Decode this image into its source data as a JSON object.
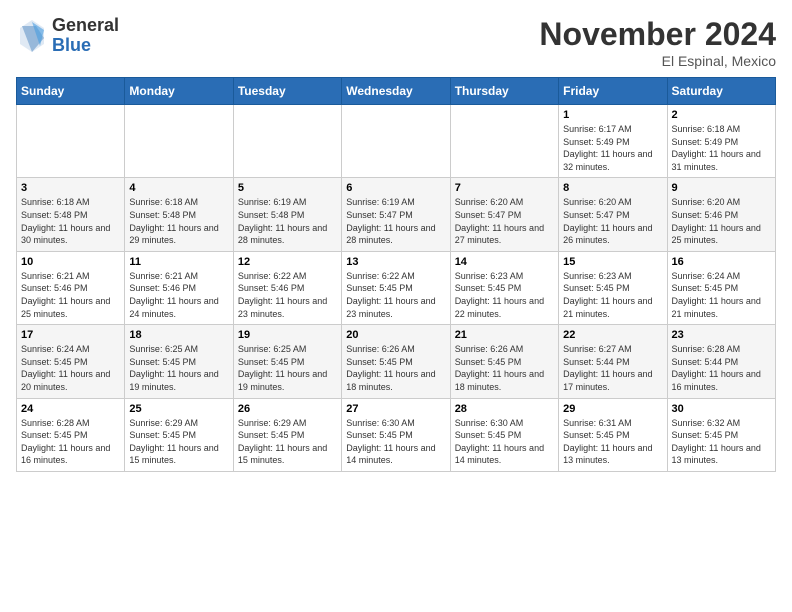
{
  "logo": {
    "general": "General",
    "blue": "Blue"
  },
  "title": "November 2024",
  "subtitle": "El Espinal, Mexico",
  "days_of_week": [
    "Sunday",
    "Monday",
    "Tuesday",
    "Wednesday",
    "Thursday",
    "Friday",
    "Saturday"
  ],
  "weeks": [
    [
      {
        "day": "",
        "info": ""
      },
      {
        "day": "",
        "info": ""
      },
      {
        "day": "",
        "info": ""
      },
      {
        "day": "",
        "info": ""
      },
      {
        "day": "",
        "info": ""
      },
      {
        "day": "1",
        "info": "Sunrise: 6:17 AM\nSunset: 5:49 PM\nDaylight: 11 hours and 32 minutes."
      },
      {
        "day": "2",
        "info": "Sunrise: 6:18 AM\nSunset: 5:49 PM\nDaylight: 11 hours and 31 minutes."
      }
    ],
    [
      {
        "day": "3",
        "info": "Sunrise: 6:18 AM\nSunset: 5:48 PM\nDaylight: 11 hours and 30 minutes."
      },
      {
        "day": "4",
        "info": "Sunrise: 6:18 AM\nSunset: 5:48 PM\nDaylight: 11 hours and 29 minutes."
      },
      {
        "day": "5",
        "info": "Sunrise: 6:19 AM\nSunset: 5:48 PM\nDaylight: 11 hours and 28 minutes."
      },
      {
        "day": "6",
        "info": "Sunrise: 6:19 AM\nSunset: 5:47 PM\nDaylight: 11 hours and 28 minutes."
      },
      {
        "day": "7",
        "info": "Sunrise: 6:20 AM\nSunset: 5:47 PM\nDaylight: 11 hours and 27 minutes."
      },
      {
        "day": "8",
        "info": "Sunrise: 6:20 AM\nSunset: 5:47 PM\nDaylight: 11 hours and 26 minutes."
      },
      {
        "day": "9",
        "info": "Sunrise: 6:20 AM\nSunset: 5:46 PM\nDaylight: 11 hours and 25 minutes."
      }
    ],
    [
      {
        "day": "10",
        "info": "Sunrise: 6:21 AM\nSunset: 5:46 PM\nDaylight: 11 hours and 25 minutes."
      },
      {
        "day": "11",
        "info": "Sunrise: 6:21 AM\nSunset: 5:46 PM\nDaylight: 11 hours and 24 minutes."
      },
      {
        "day": "12",
        "info": "Sunrise: 6:22 AM\nSunset: 5:46 PM\nDaylight: 11 hours and 23 minutes."
      },
      {
        "day": "13",
        "info": "Sunrise: 6:22 AM\nSunset: 5:45 PM\nDaylight: 11 hours and 23 minutes."
      },
      {
        "day": "14",
        "info": "Sunrise: 6:23 AM\nSunset: 5:45 PM\nDaylight: 11 hours and 22 minutes."
      },
      {
        "day": "15",
        "info": "Sunrise: 6:23 AM\nSunset: 5:45 PM\nDaylight: 11 hours and 21 minutes."
      },
      {
        "day": "16",
        "info": "Sunrise: 6:24 AM\nSunset: 5:45 PM\nDaylight: 11 hours and 21 minutes."
      }
    ],
    [
      {
        "day": "17",
        "info": "Sunrise: 6:24 AM\nSunset: 5:45 PM\nDaylight: 11 hours and 20 minutes."
      },
      {
        "day": "18",
        "info": "Sunrise: 6:25 AM\nSunset: 5:45 PM\nDaylight: 11 hours and 19 minutes."
      },
      {
        "day": "19",
        "info": "Sunrise: 6:25 AM\nSunset: 5:45 PM\nDaylight: 11 hours and 19 minutes."
      },
      {
        "day": "20",
        "info": "Sunrise: 6:26 AM\nSunset: 5:45 PM\nDaylight: 11 hours and 18 minutes."
      },
      {
        "day": "21",
        "info": "Sunrise: 6:26 AM\nSunset: 5:45 PM\nDaylight: 11 hours and 18 minutes."
      },
      {
        "day": "22",
        "info": "Sunrise: 6:27 AM\nSunset: 5:44 PM\nDaylight: 11 hours and 17 minutes."
      },
      {
        "day": "23",
        "info": "Sunrise: 6:28 AM\nSunset: 5:44 PM\nDaylight: 11 hours and 16 minutes."
      }
    ],
    [
      {
        "day": "24",
        "info": "Sunrise: 6:28 AM\nSunset: 5:45 PM\nDaylight: 11 hours and 16 minutes."
      },
      {
        "day": "25",
        "info": "Sunrise: 6:29 AM\nSunset: 5:45 PM\nDaylight: 11 hours and 15 minutes."
      },
      {
        "day": "26",
        "info": "Sunrise: 6:29 AM\nSunset: 5:45 PM\nDaylight: 11 hours and 15 minutes."
      },
      {
        "day": "27",
        "info": "Sunrise: 6:30 AM\nSunset: 5:45 PM\nDaylight: 11 hours and 14 minutes."
      },
      {
        "day": "28",
        "info": "Sunrise: 6:30 AM\nSunset: 5:45 PM\nDaylight: 11 hours and 14 minutes."
      },
      {
        "day": "29",
        "info": "Sunrise: 6:31 AM\nSunset: 5:45 PM\nDaylight: 11 hours and 13 minutes."
      },
      {
        "day": "30",
        "info": "Sunrise: 6:32 AM\nSunset: 5:45 PM\nDaylight: 11 hours and 13 minutes."
      }
    ]
  ]
}
